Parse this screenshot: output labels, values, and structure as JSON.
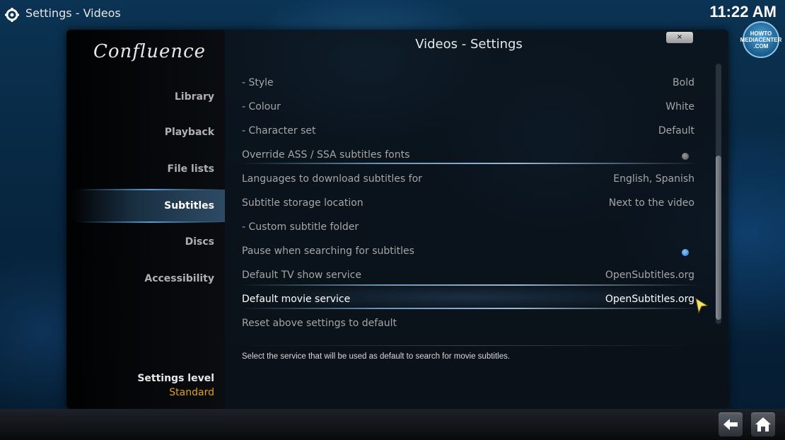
{
  "header": {
    "section": "Settings",
    "separator": " - ",
    "page": "Videos",
    "clock": "11:22 AM",
    "badge_lines": [
      "HOWTO",
      "MEDIACENTER",
      ".COM"
    ]
  },
  "sidebar": {
    "brand": "Confluence",
    "items": [
      {
        "label": "Library"
      },
      {
        "label": "Playback"
      },
      {
        "label": "File lists"
      },
      {
        "label": "Subtitles"
      },
      {
        "label": "Discs"
      },
      {
        "label": "Accessibility"
      }
    ],
    "active_item": "Subtitles",
    "settings_level_label": "Settings level",
    "settings_level_value": "Standard"
  },
  "dialog": {
    "title": "Videos - Settings",
    "close_label": "×"
  },
  "settings": [
    {
      "label": "- Style",
      "value": "Bold"
    },
    {
      "label": "- Colour",
      "value": "White"
    },
    {
      "label": "- Character set",
      "value": "Default"
    },
    {
      "label": "Override ASS / SSA subtitles fonts",
      "value": "",
      "toggle": "off"
    },
    {
      "label": "Languages to download subtitles for",
      "value": "English, Spanish"
    },
    {
      "label": "Subtitle storage location",
      "value": "Next to the video"
    },
    {
      "label": "- Custom subtitle folder",
      "value": ""
    },
    {
      "label": "Pause when searching for subtitles",
      "value": "",
      "toggle": "on"
    },
    {
      "label": "Default TV show service",
      "value": "OpenSubtitles.org"
    },
    {
      "label": "Default movie service",
      "value": "OpenSubtitles.org",
      "focused": true
    },
    {
      "label": "Reset above settings to default",
      "value": ""
    }
  ],
  "description": "Select the service that will be used as default to search for movie subtitles.",
  "colors": {
    "accent": "#e0a020",
    "toggle_on": "#1e6fd0",
    "text_dim": "#a6a6a6"
  },
  "icons": {
    "top_left": "gear-icon",
    "back": "back-arrow-icon",
    "home": "home-icon",
    "cursor": "mouse-pointer-icon"
  }
}
